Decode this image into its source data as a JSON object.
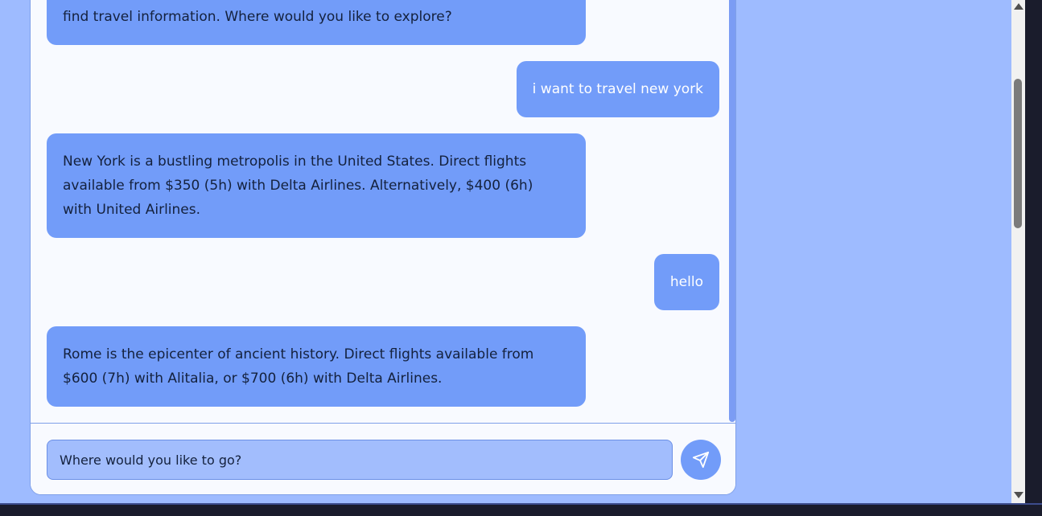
{
  "chat": {
    "messages": [
      {
        "role": "assistant",
        "lines": [
          "",
          "find travel information. Where would you like to explore?"
        ]
      },
      {
        "role": "user",
        "text": "i want to travel new york"
      },
      {
        "role": "assistant",
        "lines": [
          "New York is a bustling metropolis in the United States. Direct flights",
          "available from $350 (5h) with Delta Airlines. Alternatively, $400 (6h)",
          "with United Airlines."
        ]
      },
      {
        "role": "user",
        "text": "hello"
      },
      {
        "role": "assistant",
        "lines": [
          "Rome is the epicenter of ancient history. Direct flights available from",
          "$600 (7h) with Alitalia, or $700 (6h) with Delta Airlines."
        ]
      }
    ]
  },
  "input": {
    "placeholder": "Where would you like to go?"
  },
  "icons": {
    "send": "send-icon",
    "scroll_up": "scroll-up-arrow-icon",
    "scroll_down": "scroll-down-arrow-icon"
  },
  "colors": {
    "page_background": "#9ebbff",
    "panel_background": "#f8faff",
    "bubble": "#729cf9",
    "input_background": "#a2bdfd",
    "bot_text": "#14213d",
    "user_text": "#ffffff"
  }
}
